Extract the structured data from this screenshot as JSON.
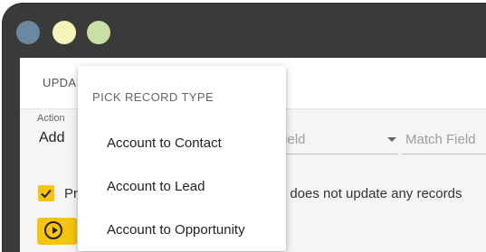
{
  "window": {
    "controls": [
      {
        "name": "window-control-close",
        "color": "#6a89a0"
      },
      {
        "name": "window-control-minimize",
        "color": "#f6f3b9"
      },
      {
        "name": "window-control-maximize",
        "color": "#c9dfa6"
      }
    ]
  },
  "header": {
    "update_label": "UPDA"
  },
  "form": {
    "action_caption": "Action",
    "action_value": "Add",
    "field_placeholder": "Field",
    "match_field_placeholder": "Match Field",
    "checkbox_label_start": "Pr",
    "checkbox_label_end": "cle does not update any records",
    "checkbox_checked": true
  },
  "dropdown": {
    "heading": "PICK RECORD TYPE",
    "options": [
      {
        "label": "Account to Contact"
      },
      {
        "label": "Account to Lead"
      },
      {
        "label": "Account to Opportunity"
      }
    ]
  },
  "colors": {
    "accent": "#f6c40a",
    "titlebar": "#3a3a3a"
  },
  "icons": {
    "checkbox": "check-icon",
    "run": "play-circle-icon",
    "select": "caret-down-icon"
  }
}
